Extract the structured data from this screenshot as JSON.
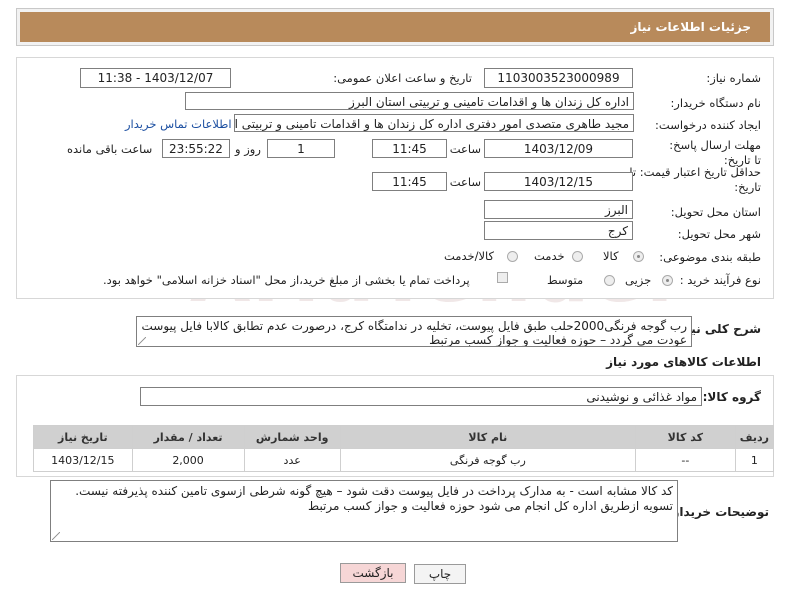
{
  "header": {
    "title": "جزئیات اطلاعات نیاز"
  },
  "fields": {
    "need_number_label": "شماره نیاز:",
    "need_number": "1103003523000989",
    "announce_label": "تاریخ و ساعت اعلان عمومی:",
    "announce_value": "1403/12/07 - 11:38",
    "buyer_org_label": "نام دستگاه خریدار:",
    "buyer_org": "اداره کل زندان ها و اقدامات تامینی و تربیتی استان البرز",
    "requester_label": "ایجاد کننده درخواست:",
    "requester": "مجید طاهری متصدی امور دفتری اداره کل زندان ها و اقدامات تامینی و تربیتی اس",
    "contact_link": "اطلاعات تماس خریدار",
    "deadline_label": "مهلت ارسال پاسخ: تا تاریخ:",
    "deadline_date": "1403/12/09",
    "time_label": "ساعت",
    "deadline_time": "11:45",
    "days_value": "1",
    "days_label": "روز و",
    "remaining_value": "23:55:22",
    "remaining_label": "ساعت باقی مانده",
    "validity_label": "حداقل تاریخ اعتبار قیمت: تا تاریخ:",
    "validity_date": "1403/12/15",
    "validity_time_label": "ساعت",
    "validity_time": "11:45",
    "province_label": "استان محل تحویل:",
    "province": "البرز",
    "city_label": "شهر محل تحویل:",
    "city": "کرج",
    "category_label": "طبقه بندی موضوعی:",
    "category_options": [
      "کالا",
      "خدمت",
      "کالا/خدمت"
    ],
    "process_label": "نوع فرآیند خرید :",
    "process_options": [
      "جزیی",
      "متوسط"
    ],
    "payment_note": "پرداخت تمام یا بخشی از مبلغ خرید،از محل \"اسناد خزانه اسلامی\" خواهد بود."
  },
  "description": {
    "label": "شرح کلی نیاز:",
    "text": "رب گوجه فرنگی2000حلب  طبق فایل پیوست، تخلیه در ندامتگاه کرج، درصورت عدم تطابق کالابا فایل پیوست عودت می گردد – حوزه فعالیت و جواز کسب مرتبط"
  },
  "goods": {
    "section_title": "اطلاعات کالاهای مورد نیاز",
    "group_label": "گروه کالا:",
    "group_value": "مواد غذائی و نوشیدنی",
    "table": {
      "headers": [
        "ردیف",
        "کد کالا",
        "نام کالا",
        "واحد شمارش",
        "تعداد / مقدار",
        "تاریخ نیاز"
      ],
      "rows": [
        [
          "1",
          "--",
          "رب گوجه فرنگی",
          "عدد",
          "2,000",
          "1403/12/15"
        ]
      ]
    }
  },
  "buyer_notes": {
    "label": "توضیحات خریدار:",
    "text": "کد کالا مشابه است - به مدارک پرداخت در فایل پیوست دقت شود – هیچ گونه شرطی ازسوی تامین کننده پذیرفته نیست. تسویه ازطریق اداره کل انجام می شود حوزه فعالیت و جواز کسب مرتبط"
  },
  "buttons": {
    "print": "چاپ",
    "back": "بازگشت"
  },
  "colors": {
    "header_bg": "#b88a5b",
    "link": "#1c4fa1",
    "back_btn_bg": "#f6d6d6"
  }
}
